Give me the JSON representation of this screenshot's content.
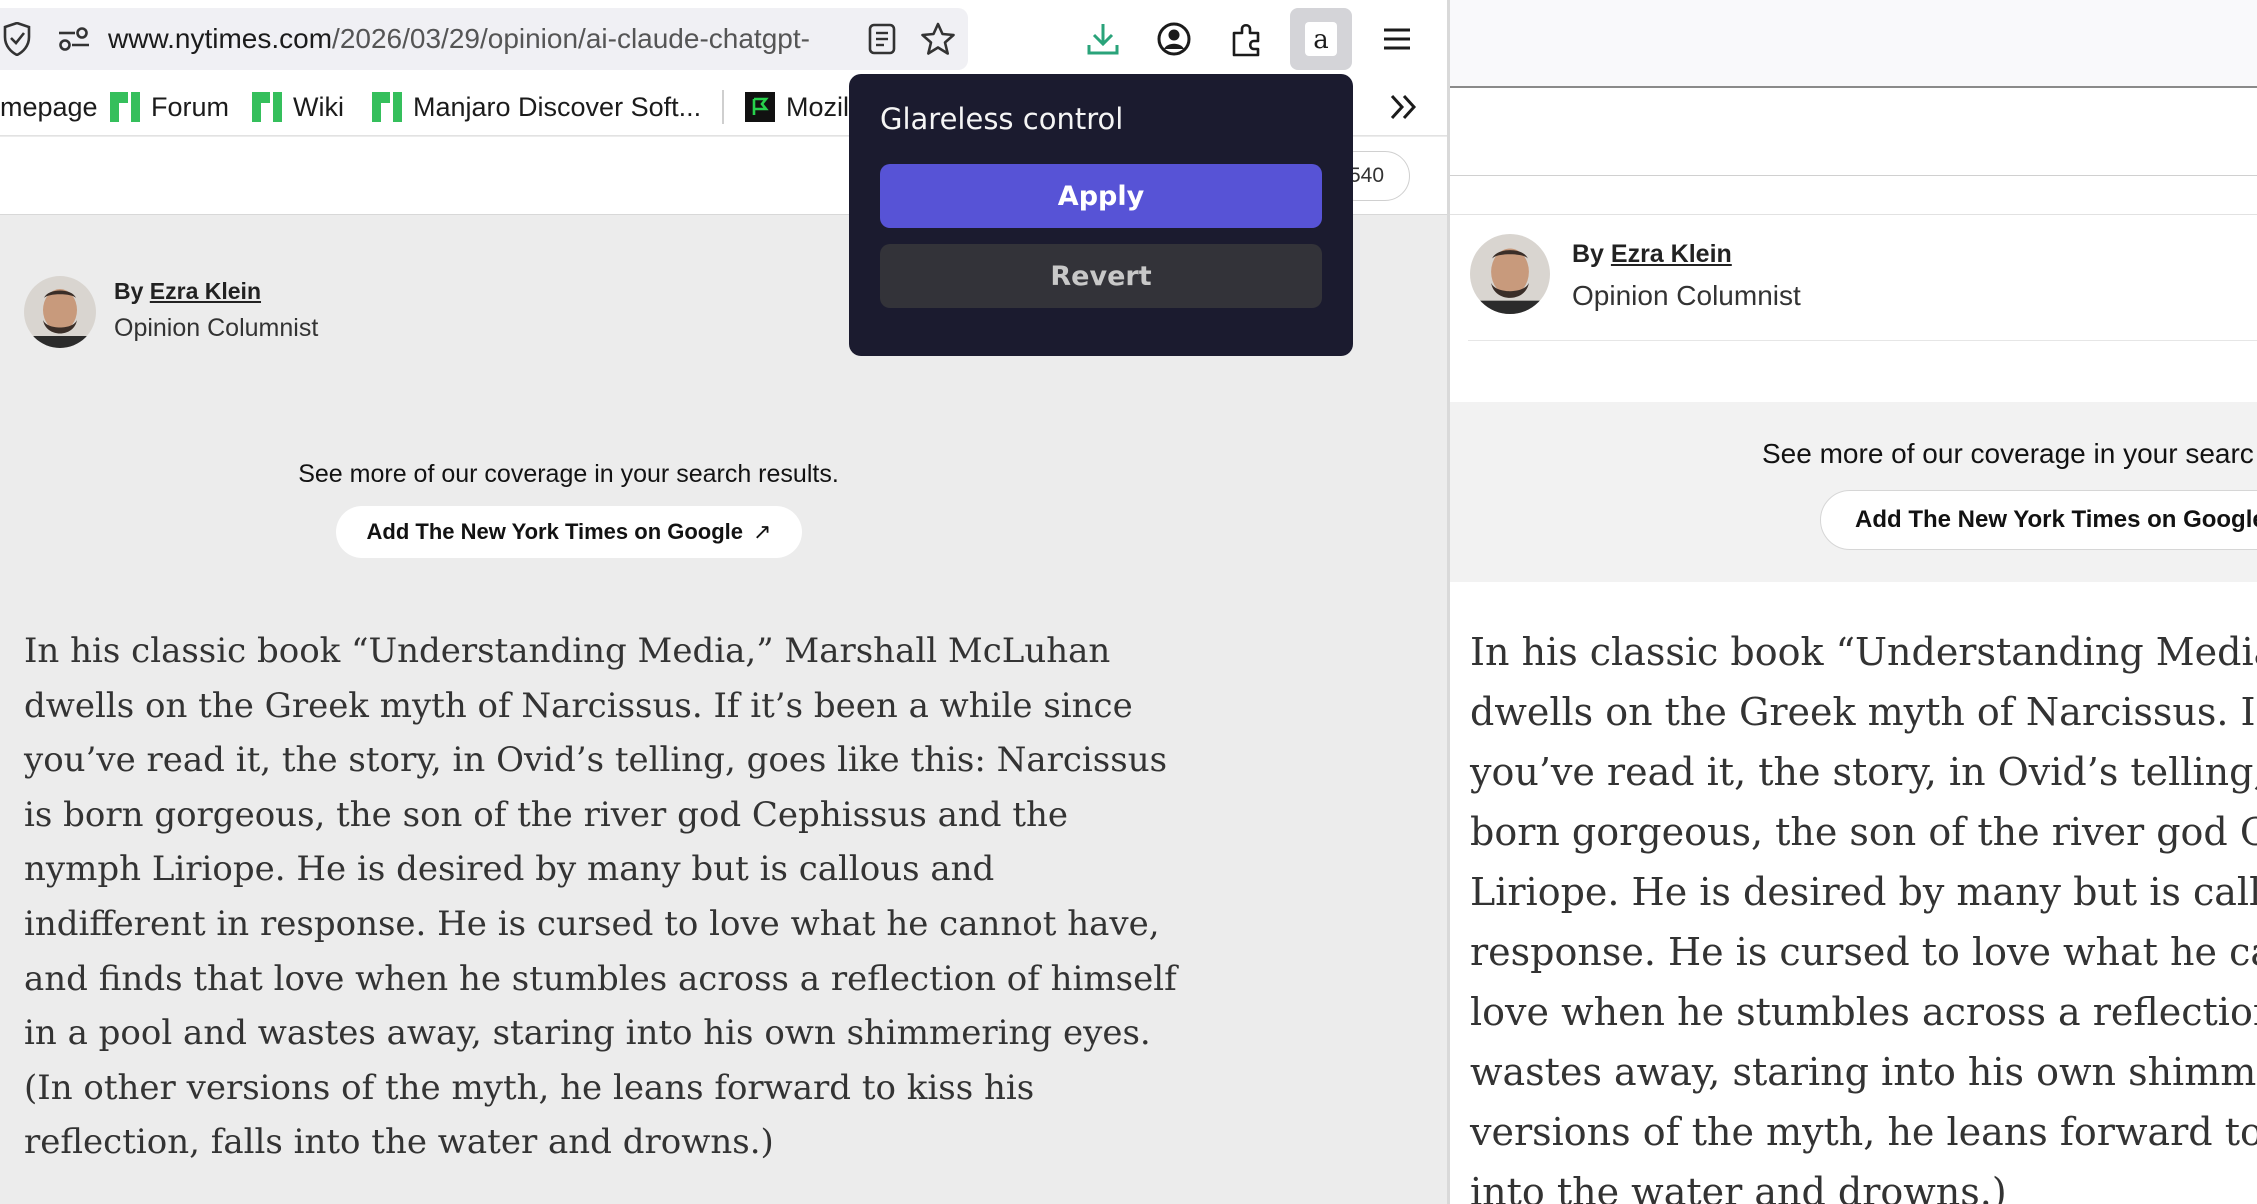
{
  "browser": {
    "url_host": "www.nytimes.com",
    "url_path": "/2026/03/29/opinion/ai-claude-chatgpt-",
    "bookmarks": [
      {
        "label": "mepage",
        "icon": "page-icon"
      },
      {
        "label": "Forum",
        "icon": "manjaro-icon"
      },
      {
        "label": "Wiki",
        "icon": "manjaro-icon"
      },
      {
        "label": "Manjaro Discover Soft...",
        "icon": "manjaro-icon"
      },
      {
        "label": "Mozil",
        "icon": "mozilla-icon"
      }
    ],
    "overflow_label": "»"
  },
  "nyt_header": {
    "subscribe_fragment": "540"
  },
  "popup": {
    "title": "Glareless control",
    "apply_label": "Apply",
    "revert_label": "Revert",
    "extension_icon_letter": "a"
  },
  "byline": {
    "by": "By ",
    "author": "Ezra Klein",
    "role": "Opinion Columnist"
  },
  "cta": {
    "text_left": "See more of our coverage in your search results.",
    "text_right": "See more of our coverage in your searc",
    "button_label": "Add The New York Times on Google",
    "button_label_right": "Add The New York Times on Google",
    "arrow": "↗"
  },
  "article_left": [
    "In his classic book “Understanding Media,” Marshall McLuhan",
    "dwells on the Greek myth of Narcissus. If it’s been a while since",
    "you’ve read it, the story, in Ovid’s telling, goes like this:  Narcissus",
    "is born gorgeous, the son of the river god Cephissus and the",
    "nymph Liriope. He is desired by many but is callous and",
    "indifferent in response. He is cursed to love what he cannot have,",
    "and finds that love when he stumbles across a reflection of himself",
    "in a pool and wastes away, staring into his own shimmering eyes.",
    "(In other versions of the myth, he leans forward to kiss his",
    "reflection, falls into the water and drowns.)"
  ],
  "article_right": [
    "In his classic book “Understanding Media,” M",
    "dwells on the Greek myth of Narcissus. If it’s",
    "you’ve read it, the story, in Ovid’s telling, goe",
    "born gorgeous, the son of the river god Cephi",
    "Liriope. He is desired by many but is callous",
    "response. He is cursed to love what he canno",
    "love when he stumbles across a reflection of",
    "wastes away, staring into his own shimmerin",
    "versions of the myth, he leans forward to kis",
    "into the water and drowns.)"
  ],
  "colors": {
    "popup_bg": "#1b1b2f",
    "apply_bg": "#5753d6",
    "revert_bg": "#333339",
    "download_green": "#2aa37a",
    "manjaro_green": "#35bf5c"
  }
}
